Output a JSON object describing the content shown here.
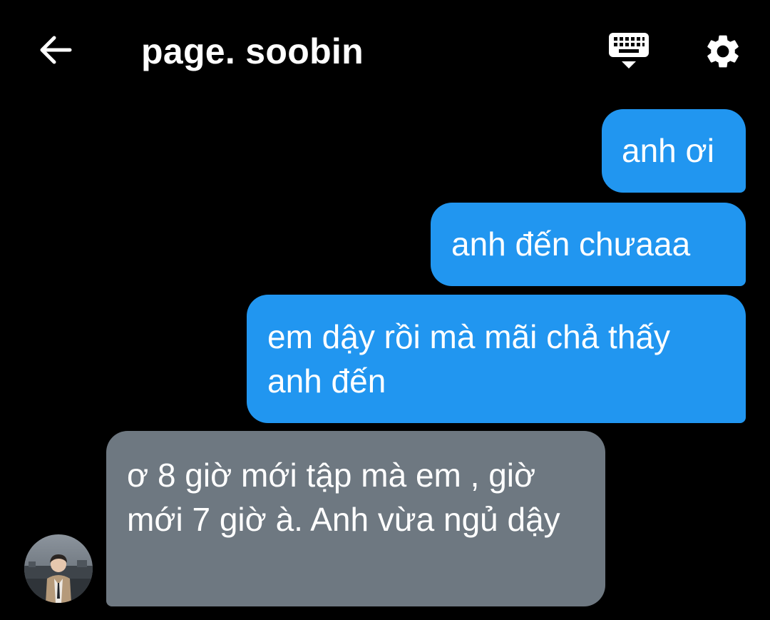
{
  "header": {
    "title": "page. soobin",
    "back_icon": "arrow-left-icon",
    "keyboard_icon": "keyboard-hide-icon",
    "settings_icon": "gear-icon"
  },
  "messages": [
    {
      "direction": "outgoing",
      "text": "anh ơi"
    },
    {
      "direction": "outgoing",
      "text": "anh đến chưaaa"
    },
    {
      "direction": "outgoing",
      "text": "em dậy rồi mà mãi chả thấy anh đến"
    },
    {
      "direction": "incoming",
      "text": "ơ 8 giờ mới tập mà em , giờ mới 7 giờ à. Anh vừa ngủ dậy"
    }
  ],
  "colors": {
    "background": "#000000",
    "outgoing_bubble": "#2196f0",
    "incoming_bubble": "#6e7881",
    "text": "#ffffff"
  }
}
